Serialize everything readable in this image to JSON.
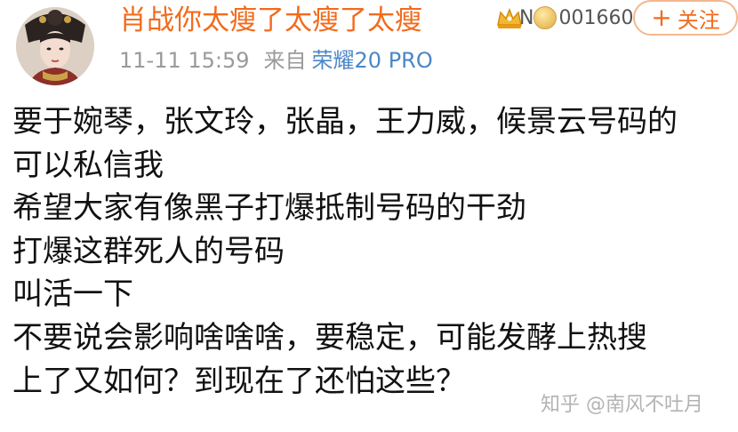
{
  "post": {
    "username": "肖战你太瘦了太瘦了太瘦",
    "badge_prefix": "N",
    "badge_number": "001660",
    "follow_label": "关注",
    "timestamp": "11-11 15:59",
    "source_prefix": "来自",
    "device": "荣耀20 PRO",
    "lines": [
      "要于婉琴，张文玲，张晶，王力威，候景云号码的",
      "可以私信我",
      "希望大家有像黑子打爆抵制号码的干劲",
      "打爆这群死人的号码",
      "叫活一下",
      "不要说会影响啥啥啥，要稳定，可能发酵上热搜",
      "上了又如何？到现在了还怕这些？"
    ]
  },
  "watermark": "知乎 @南风不吐月",
  "colors": {
    "username": "#f26b1c",
    "device": "#4a87c6",
    "meta": "#9a9a9a",
    "body": "#111111"
  },
  "icons": [
    "avatar",
    "vip-crown-icon",
    "fan-medal-icon",
    "plus-icon"
  ]
}
